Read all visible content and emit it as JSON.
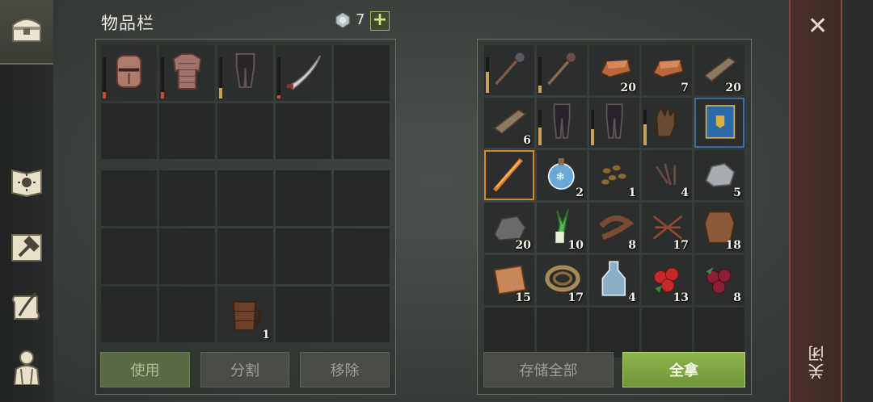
{
  "header": {
    "title": "物品栏",
    "gem_count": "7",
    "add_label": "+"
  },
  "sidebar": {
    "items": [
      {
        "name": "chest-icon"
      },
      {
        "name": "sun-book-icon"
      },
      {
        "name": "craft-hammer-icon"
      },
      {
        "name": "scroll-quill-icon"
      },
      {
        "name": "character-icon"
      }
    ]
  },
  "left_inventory": {
    "equipment": [
      {
        "name": "great-helm",
        "durability": 0.15,
        "dur_color": "#c24a3a"
      },
      {
        "name": "chainmail-armor",
        "durability": 0.15,
        "dur_color": "#c24a3a"
      },
      {
        "name": "leather-pants",
        "durability": 0.25,
        "dur_color": "#c9a25a"
      },
      {
        "name": "scimitar",
        "durability": 0.08,
        "dur_color": "#c24a3a"
      },
      {
        "name": ""
      }
    ],
    "backpack_item": {
      "name": "wooden-mug",
      "count": "1"
    }
  },
  "right_storage": {
    "items": [
      {
        "name": "spiked-mace",
        "count": "",
        "durability": 0.6,
        "dur_color": "#c9a25a"
      },
      {
        "name": "flail-mace",
        "count": "",
        "durability": 0.2,
        "dur_color": "#c9a25a"
      },
      {
        "name": "copper-ingot",
        "count": "20"
      },
      {
        "name": "copper-ingot",
        "count": "7"
      },
      {
        "name": "wood-plank",
        "count": "20"
      },
      {
        "name": "wood-plank",
        "count": "6"
      },
      {
        "name": "dark-pants",
        "count": "",
        "durability": 0.5,
        "dur_color": "#c9a25a"
      },
      {
        "name": "dark-pants",
        "count": "",
        "durability": 0.45,
        "dur_color": "#c9a25a"
      },
      {
        "name": "leather-gloves",
        "count": "",
        "durability": 0.6,
        "dur_color": "#c9a25a"
      },
      {
        "name": "blue-tome",
        "count": ""
      },
      {
        "name": "flame-sword",
        "count": ""
      },
      {
        "name": "frost-potion",
        "count": "2"
      },
      {
        "name": "seeds",
        "count": "1"
      },
      {
        "name": "nails",
        "count": "4"
      },
      {
        "name": "iron-ore",
        "count": "5"
      },
      {
        "name": "stone",
        "count": "20"
      },
      {
        "name": "leek",
        "count": "10"
      },
      {
        "name": "leather-strap",
        "count": "8"
      },
      {
        "name": "plant-fiber",
        "count": "17"
      },
      {
        "name": "animal-hide",
        "count": "18"
      },
      {
        "name": "cloth",
        "count": "15"
      },
      {
        "name": "rope",
        "count": "17"
      },
      {
        "name": "water-bottle",
        "count": "4"
      },
      {
        "name": "red-berries",
        "count": "13"
      },
      {
        "name": "dark-berries",
        "count": "8"
      }
    ]
  },
  "buttons": {
    "use": "使用",
    "split": "分割",
    "remove": "移除",
    "store_all": "存储全部",
    "take_all": "全拿"
  },
  "close": {
    "icon": "close-icon",
    "label": "关闭"
  }
}
